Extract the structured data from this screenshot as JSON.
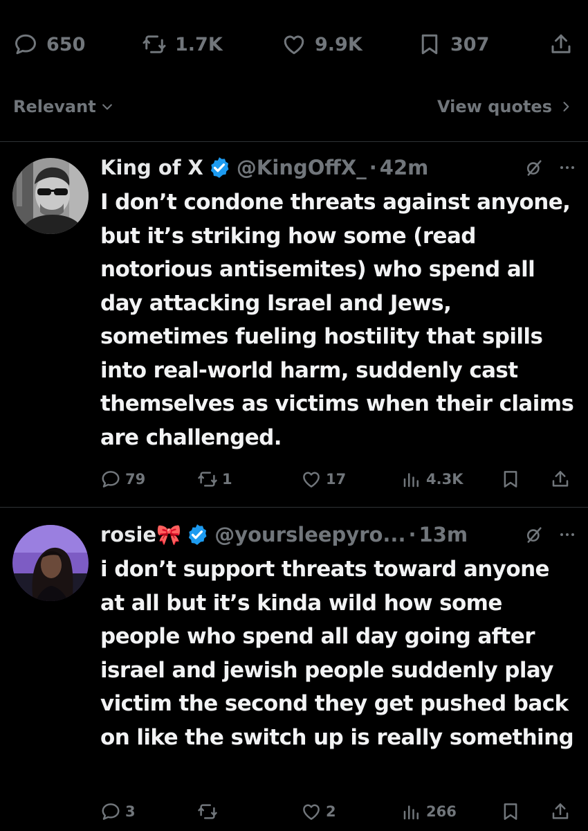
{
  "main_actions": {
    "replies": "650",
    "reposts": "1.7K",
    "likes": "9.9K",
    "bookmarks": "307"
  },
  "sort": {
    "label": "Relevant"
  },
  "quotes_link": {
    "label": "View quotes"
  },
  "replies": [
    {
      "name": "King of X",
      "handle": "@KingOffX_",
      "separator": "·",
      "time": "42m",
      "text": "I don’t condone threats against anyone, but it’s striking how some (read notorious antisemites) who spend all day attacking Israel and Jews, sometimes fueling hostility that spills into real-world harm, suddenly cast themselves as victims when their claims are challenged.",
      "stats": {
        "replies": "79",
        "reposts": "1",
        "likes": "17",
        "views": "4.3K"
      }
    },
    {
      "name": "rosie🎀",
      "handle": "@yoursleepyro...",
      "separator": "·",
      "time": "13m",
      "text": "i don’t support threats toward anyone at all but it’s kinda wild how some people who spend all day going after israel and jewish people suddenly play victim the second they get pushed back on like the switch up is really something",
      "stats": {
        "replies": "3",
        "reposts": "",
        "likes": "2",
        "views": "266"
      }
    }
  ],
  "colors": {
    "background": "#000000",
    "text": "#e7e9ea",
    "muted": "#71767b",
    "verified": "#1d9bf0",
    "divider": "#2f3336"
  },
  "icons": [
    "reply-icon",
    "repost-icon",
    "like-icon",
    "bookmark-icon",
    "share-icon",
    "views-icon",
    "verified-icon",
    "grok-icon",
    "more-icon",
    "chevron-down-icon",
    "chevron-right-icon"
  ]
}
